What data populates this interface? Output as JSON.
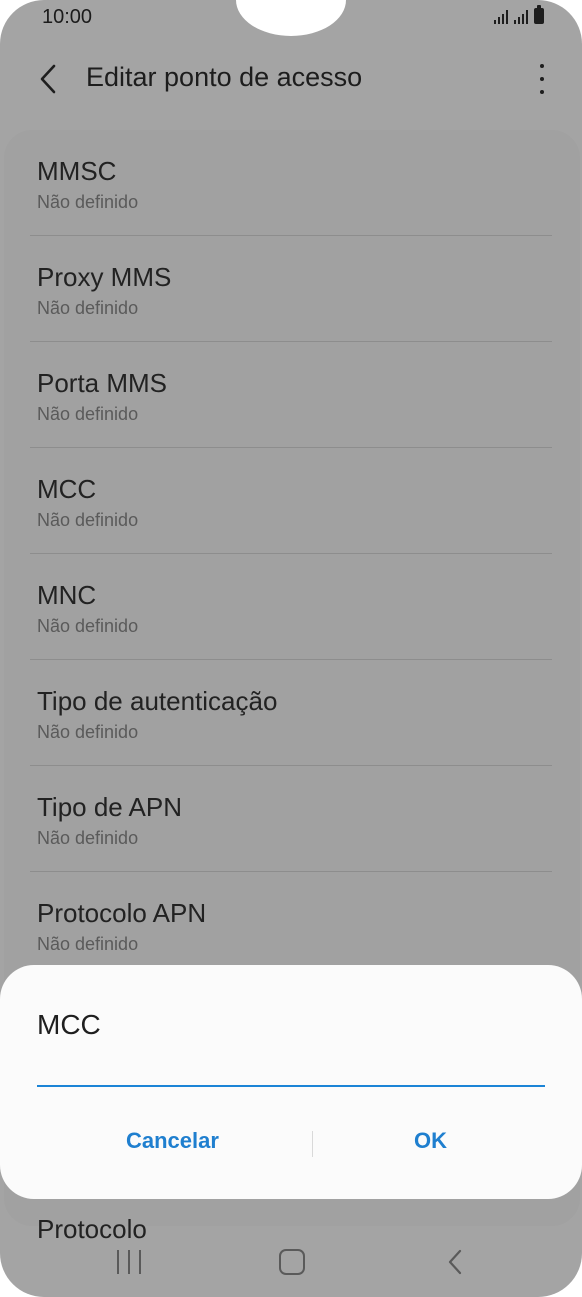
{
  "status_bar": {
    "time": "10:00"
  },
  "app_bar": {
    "title": "Editar ponto de acesso"
  },
  "settings": [
    {
      "label": "MMSC",
      "value": "Não definido"
    },
    {
      "label": "Proxy MMS",
      "value": "Não definido"
    },
    {
      "label": "Porta MMS",
      "value": "Não definido"
    },
    {
      "label": "MCC",
      "value": "Não definido"
    },
    {
      "label": "MNC",
      "value": "Não definido"
    },
    {
      "label": "Tipo de autenticação",
      "value": "Não definido"
    },
    {
      "label": "Tipo de APN",
      "value": "Não definido"
    },
    {
      "label": "Protocolo APN",
      "value": "Não definido"
    }
  ],
  "partially_hidden_item": "Protocolo",
  "dialog": {
    "title": "MCC",
    "input_value": "",
    "cancel_label": "Cancelar",
    "ok_label": "OK"
  },
  "colors": {
    "accent": "#1f7fcf",
    "scrim": "#a4a4a4",
    "dialog_bg": "#fbfbfb"
  }
}
